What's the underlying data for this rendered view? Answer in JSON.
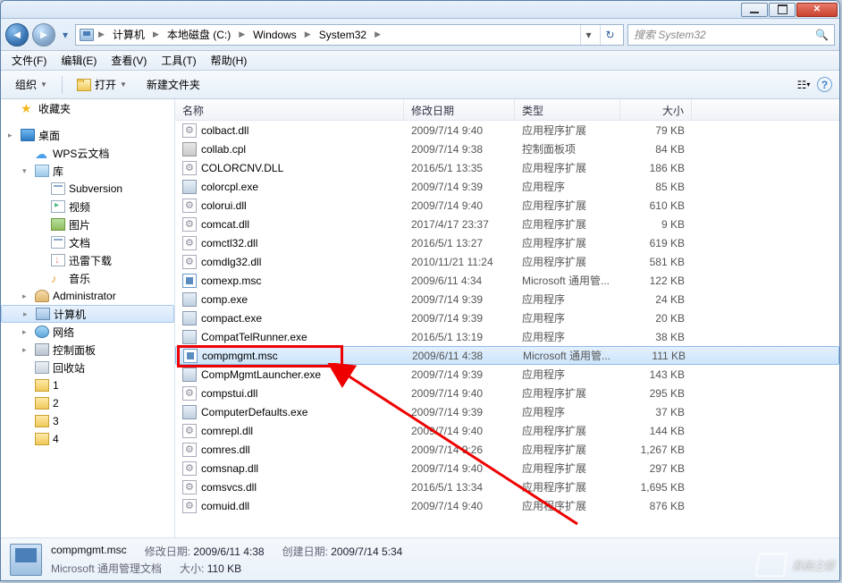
{
  "breadcrumbs": [
    "计算机",
    "本地磁盘 (C:)",
    "Windows",
    "System32"
  ],
  "search_placeholder": "搜索 System32",
  "menubar": [
    "文件(F)",
    "编辑(E)",
    "查看(V)",
    "工具(T)",
    "帮助(H)"
  ],
  "toolbar": {
    "organize": "组织",
    "open": "打开",
    "newfolder": "新建文件夹"
  },
  "columns": {
    "name": "名称",
    "date": "修改日期",
    "type": "类型",
    "size": "大小"
  },
  "sidebar": [
    {
      "label": "收藏夹",
      "icon": "star",
      "indent": 0,
      "expander": ""
    },
    {
      "spacer": true
    },
    {
      "label": "桌面",
      "icon": "desktop",
      "indent": 0,
      "expander": "▸"
    },
    {
      "label": "WPS云文档",
      "icon": "cloud",
      "indent": 1,
      "expander": ""
    },
    {
      "label": "库",
      "icon": "lib-folder",
      "indent": 1,
      "expander": "▾"
    },
    {
      "label": "Subversion",
      "icon": "doc",
      "indent": 2,
      "expander": ""
    },
    {
      "label": "视频",
      "icon": "vid",
      "indent": 2,
      "expander": ""
    },
    {
      "label": "图片",
      "icon": "img",
      "indent": 2,
      "expander": ""
    },
    {
      "label": "文档",
      "icon": "doc",
      "indent": 2,
      "expander": ""
    },
    {
      "label": "迅雷下载",
      "icon": "dl",
      "indent": 2,
      "expander": ""
    },
    {
      "label": "音乐",
      "icon": "music",
      "indent": 2,
      "expander": ""
    },
    {
      "label": "Administrator",
      "icon": "user",
      "indent": 1,
      "expander": "▸"
    },
    {
      "label": "计算机",
      "icon": "pc",
      "indent": 1,
      "expander": "▸",
      "selected": true
    },
    {
      "label": "网络",
      "icon": "net",
      "indent": 1,
      "expander": "▸"
    },
    {
      "label": "控制面板",
      "icon": "ctrl",
      "indent": 1,
      "expander": "▸"
    },
    {
      "label": "回收站",
      "icon": "bin",
      "indent": 1,
      "expander": ""
    },
    {
      "label": "1",
      "icon": "folder",
      "indent": 1,
      "expander": ""
    },
    {
      "label": "2",
      "icon": "folder",
      "indent": 1,
      "expander": ""
    },
    {
      "label": "3",
      "icon": "folder",
      "indent": 1,
      "expander": ""
    },
    {
      "label": "4",
      "icon": "folder",
      "indent": 1,
      "expander": ""
    }
  ],
  "files": [
    {
      "name": "colbact.dll",
      "date": "2009/7/14 9:40",
      "type": "应用程序扩展",
      "size": "79 KB",
      "ico": "dll"
    },
    {
      "name": "collab.cpl",
      "date": "2009/7/14 9:38",
      "type": "控制面板项",
      "size": "84 KB",
      "ico": "cpl"
    },
    {
      "name": "COLORCNV.DLL",
      "date": "2016/5/1 13:35",
      "type": "应用程序扩展",
      "size": "186 KB",
      "ico": "dll"
    },
    {
      "name": "colorcpl.exe",
      "date": "2009/7/14 9:39",
      "type": "应用程序",
      "size": "85 KB",
      "ico": "exe"
    },
    {
      "name": "colorui.dll",
      "date": "2009/7/14 9:40",
      "type": "应用程序扩展",
      "size": "610 KB",
      "ico": "dll"
    },
    {
      "name": "comcat.dll",
      "date": "2017/4/17 23:37",
      "type": "应用程序扩展",
      "size": "9 KB",
      "ico": "dll"
    },
    {
      "name": "comctl32.dll",
      "date": "2016/5/1 13:27",
      "type": "应用程序扩展",
      "size": "619 KB",
      "ico": "dll"
    },
    {
      "name": "comdlg32.dll",
      "date": "2010/11/21 11:24",
      "type": "应用程序扩展",
      "size": "581 KB",
      "ico": "dll"
    },
    {
      "name": "comexp.msc",
      "date": "2009/6/11 4:34",
      "type": "Microsoft 通用管...",
      "size": "122 KB",
      "ico": "msc"
    },
    {
      "name": "comp.exe",
      "date": "2009/7/14 9:39",
      "type": "应用程序",
      "size": "24 KB",
      "ico": "exe"
    },
    {
      "name": "compact.exe",
      "date": "2009/7/14 9:39",
      "type": "应用程序",
      "size": "20 KB",
      "ico": "exe"
    },
    {
      "name": "CompatTelRunner.exe",
      "date": "2016/5/1 13:19",
      "type": "应用程序",
      "size": "38 KB",
      "ico": "exe"
    },
    {
      "name": "compmgmt.msc",
      "date": "2009/6/11 4:38",
      "type": "Microsoft 通用管...",
      "size": "111 KB",
      "ico": "msc",
      "selected": true
    },
    {
      "name": "CompMgmtLauncher.exe",
      "date": "2009/7/14 9:39",
      "type": "应用程序",
      "size": "143 KB",
      "ico": "exe"
    },
    {
      "name": "compstui.dll",
      "date": "2009/7/14 9:40",
      "type": "应用程序扩展",
      "size": "295 KB",
      "ico": "dll"
    },
    {
      "name": "ComputerDefaults.exe",
      "date": "2009/7/14 9:39",
      "type": "应用程序",
      "size": "37 KB",
      "ico": "exe"
    },
    {
      "name": "comrepl.dll",
      "date": "2009/7/14 9:40",
      "type": "应用程序扩展",
      "size": "144 KB",
      "ico": "dll"
    },
    {
      "name": "comres.dll",
      "date": "2009/7/14 9:26",
      "type": "应用程序扩展",
      "size": "1,267 KB",
      "ico": "dll"
    },
    {
      "name": "comsnap.dll",
      "date": "2009/7/14 9:40",
      "type": "应用程序扩展",
      "size": "297 KB",
      "ico": "dll"
    },
    {
      "name": "comsvcs.dll",
      "date": "2016/5/1 13:34",
      "type": "应用程序扩展",
      "size": "1,695 KB",
      "ico": "dll"
    },
    {
      "name": "comuid.dll",
      "date": "2009/7/14 9:40",
      "type": "应用程序扩展",
      "size": "876 KB",
      "ico": "dll"
    }
  ],
  "details": {
    "filename": "compmgmt.msc",
    "filetype": "Microsoft 通用管理文档",
    "mod_label": "修改日期:",
    "mod_val": "2009/6/11 4:38",
    "size_label": "大小:",
    "size_val": "110 KB",
    "created_label": "创建日期:",
    "created_val": "2009/7/14 5:34"
  },
  "watermark": "系统之家"
}
